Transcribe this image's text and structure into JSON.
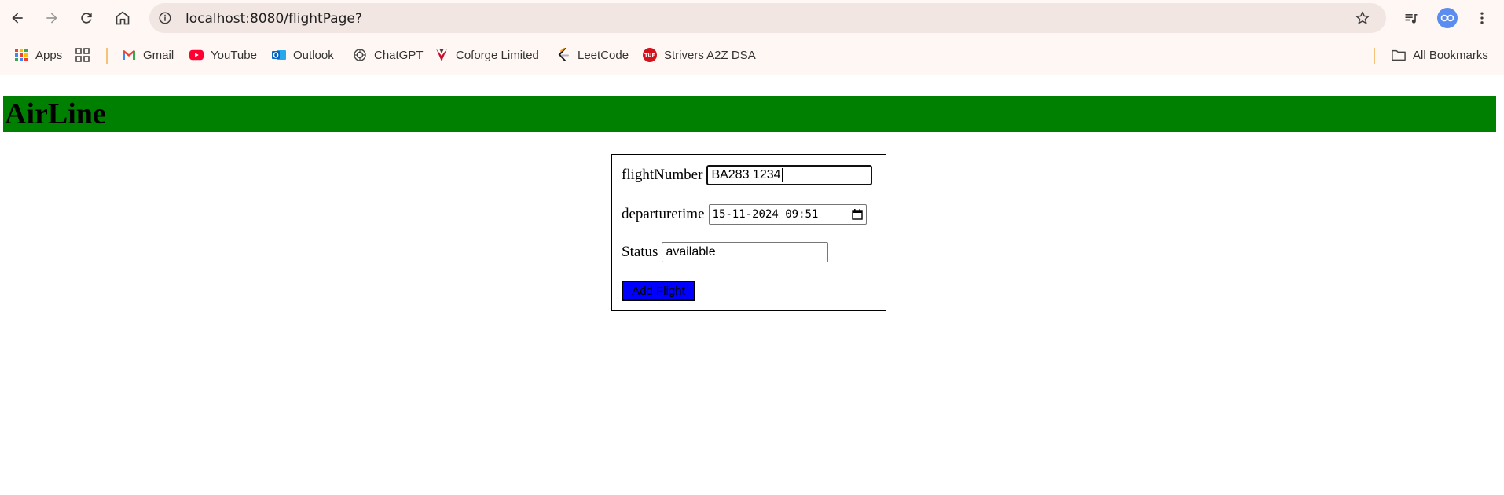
{
  "browser": {
    "url": "localhost:8080/flightPage?",
    "bookmarks": [
      {
        "label": "Apps",
        "icon": "apps-grid-icon"
      },
      {
        "label": "Gmail",
        "icon": "gmail-icon"
      },
      {
        "label": "YouTube",
        "icon": "youtube-icon"
      },
      {
        "label": "Outlook",
        "icon": "outlook-icon"
      },
      {
        "label": "ChatGPT",
        "icon": "chatgpt-icon"
      },
      {
        "label": "Coforge Limited",
        "icon": "coforge-icon"
      },
      {
        "label": "LeetCode",
        "icon": "leetcode-icon"
      },
      {
        "label": "Strivers A2Z DSA",
        "icon": "tuf-icon"
      }
    ],
    "all_bookmarks_label": "All Bookmarks"
  },
  "page": {
    "title": "AirLine",
    "header_color": "#008000"
  },
  "form": {
    "flight_number": {
      "label": "flightNumber",
      "value": "BA283 1234"
    },
    "departure_time": {
      "label": "departuretime",
      "value": "15-11-2024 09:51"
    },
    "status": {
      "label": "Status",
      "value": "available"
    },
    "submit_label": "Add Flight",
    "submit_color": "#0000ff"
  }
}
